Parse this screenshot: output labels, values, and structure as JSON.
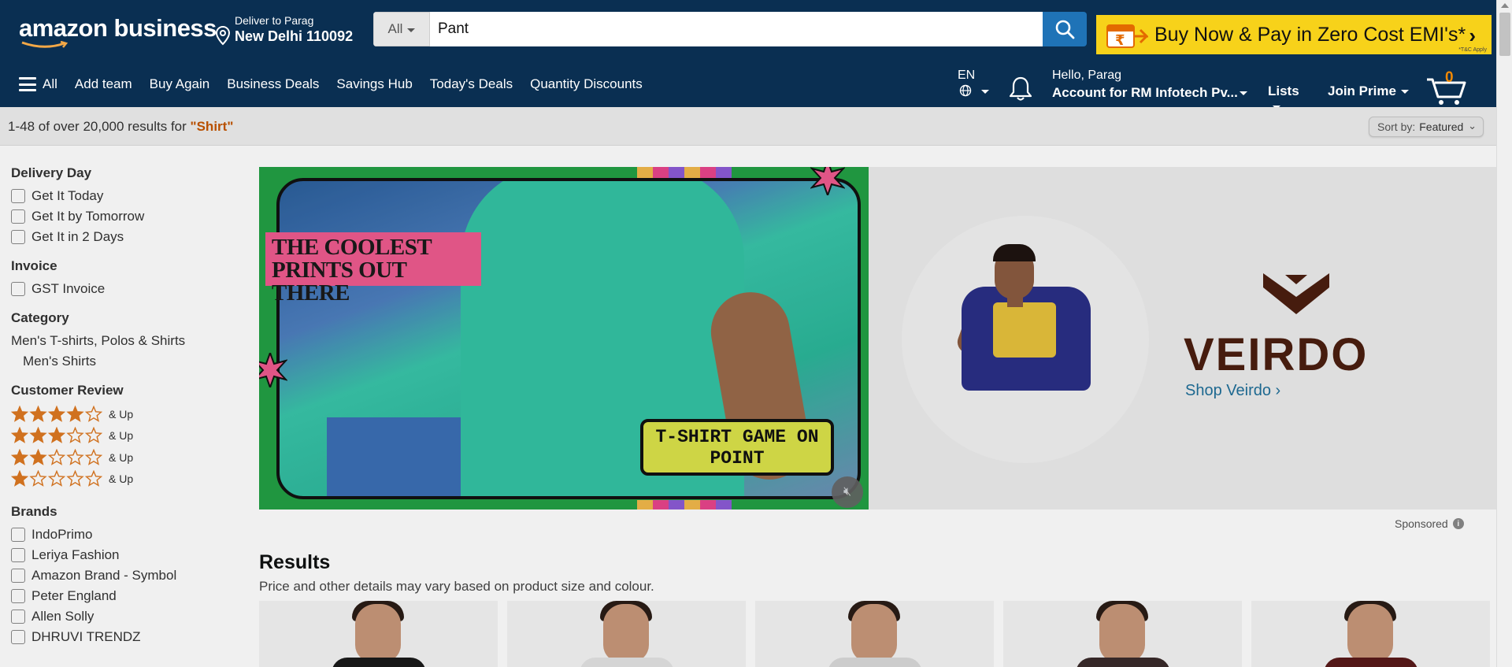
{
  "header": {
    "logo_text": "amazon business",
    "deliver_line1": "Deliver to Parag",
    "deliver_line2": "New Delhi 110092",
    "search_category": "All",
    "search_value": "Pant",
    "promo_text": "Buy Now & Pay in Zero Cost EMI's*",
    "promo_tbc": "*T&C Apply",
    "brand_color": "#0a2f52",
    "search_button_color": "#1f73b7",
    "promo_color": "#f7d21a"
  },
  "nav": {
    "all_label": "All",
    "items": [
      "Add team",
      "Buy Again",
      "Business Deals",
      "Savings Hub",
      "Today's Deals",
      "Quantity Discounts"
    ],
    "lang": "EN",
    "account_line1": "Hello, Parag",
    "account_line2": "Account for RM Infotech Pv...",
    "lists": "Lists",
    "prime": "Join Prime",
    "cart_count": "0"
  },
  "results_bar": {
    "count_text": "1-48 of over 20,000 results for ",
    "query": "\"Shirt\"",
    "sort_label": "Sort by:",
    "sort_value": "Featured"
  },
  "sidebar": {
    "delivery": {
      "title": "Delivery Day",
      "options": [
        "Get It Today",
        "Get It by Tomorrow",
        "Get It in 2 Days"
      ]
    },
    "invoice": {
      "title": "Invoice",
      "options": [
        "GST Invoice"
      ]
    },
    "category": {
      "title": "Category",
      "parent": "Men's T-shirts, Polos & Shirts",
      "child": "Men's Shirts"
    },
    "review": {
      "title": "Customer Review",
      "rows": [
        {
          "stars": 4,
          "label": "& Up"
        },
        {
          "stars": 3,
          "label": "& Up"
        },
        {
          "stars": 2,
          "label": "& Up"
        },
        {
          "stars": 1,
          "label": "& Up"
        }
      ]
    },
    "brands": {
      "title": "Brands",
      "options": [
        "IndoPrimo",
        "Leriya Fashion",
        "Amazon Brand - Symbol",
        "Peter England",
        "Allen Solly",
        "DHRUVI TRENDZ"
      ]
    }
  },
  "ad": {
    "video_tag": "THE COOLEST PRINTS OUT THERE",
    "video_caption": "T-SHIRT GAME ON POINT",
    "brand_name": "VEIRDO",
    "shop_link": "Shop Veirdo ›",
    "sponsored": "Sponsored"
  },
  "results": {
    "heading": "Results",
    "subheading": "Price and other details may vary based on product size and colour.",
    "card_count": 5
  }
}
